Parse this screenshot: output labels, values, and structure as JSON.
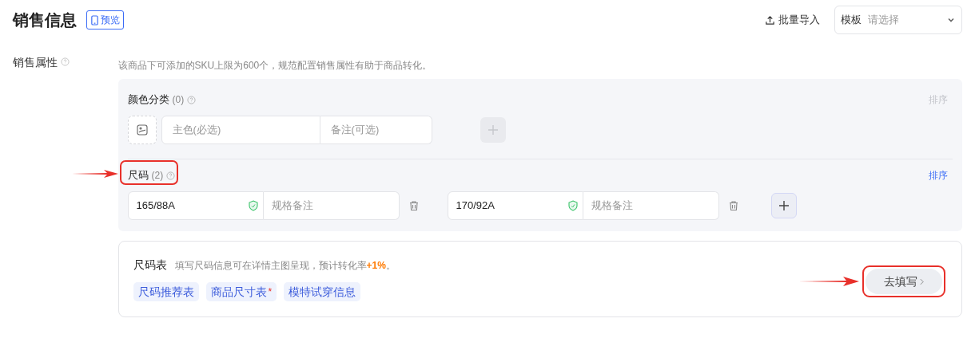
{
  "header": {
    "title": "销售信息",
    "preview_button": "预览",
    "import_button": "批量导入",
    "template_select": {
      "label": "模板",
      "placeholder": "请选择"
    }
  },
  "sales_attributes": {
    "label": "销售属性",
    "hint": "该商品下可添加的SKU上限为600个，规范配置销售属性有助于商品转化。",
    "sections": [
      {
        "kind": "color",
        "title": "颜色分类",
        "count": "(0)",
        "sort_button": "排序",
        "sort_disabled": true,
        "add_disabled": true,
        "fields": [
          {
            "main_placeholder": "主色(必选)",
            "note_placeholder": "备注(可选)"
          }
        ]
      },
      {
        "kind": "size",
        "title": "尺码",
        "count": "(2)",
        "sort_button": "排序",
        "sort_disabled": false,
        "add_disabled": false,
        "highlighted": true,
        "fields": [
          {
            "value": "165/88A",
            "note_placeholder": "规格备注"
          },
          {
            "value": "170/92A",
            "note_placeholder": "规格备注"
          }
        ]
      }
    ]
  },
  "size_chart": {
    "title": "尺码表",
    "hint_before": "填写尺码信息可在详情主图呈现，预计转化率",
    "hint_highlight": "+1%",
    "hint_after": "。",
    "fill_button": "去填写",
    "fill_button_highlighted": true,
    "tags": [
      {
        "label": "尺码推荐表",
        "required": false
      },
      {
        "label": "商品尺寸表",
        "required": true,
        "required_mark": "*"
      },
      {
        "label": "模特试穿信息",
        "required": false
      }
    ]
  }
}
